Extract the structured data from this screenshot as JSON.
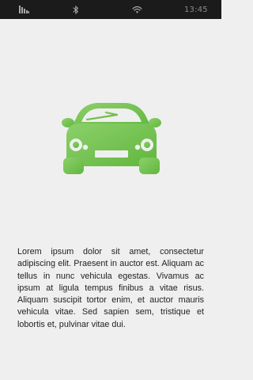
{
  "status_bar": {
    "time": "13:45",
    "icons": [
      "signal-icon",
      "bluetooth-icon",
      "wifi-icon"
    ]
  },
  "hero": {
    "icon": "car-icon",
    "color_start": "#8cd06b",
    "color_end": "#61b63d"
  },
  "content": {
    "body": "Lorem ipsum dolor sit amet, consectetur adipiscing elit. Praesent in auctor est. Aliquam ac tellus in nunc vehicula egestas. Vivamus ac ipsum at ligula tempus finibus a vitae risus. Aliquam suscipit tortor enim, et auctor mauris vehicula vitae. Sed sapien sem, tristique et lobortis et, pulvinar vitae dui."
  }
}
